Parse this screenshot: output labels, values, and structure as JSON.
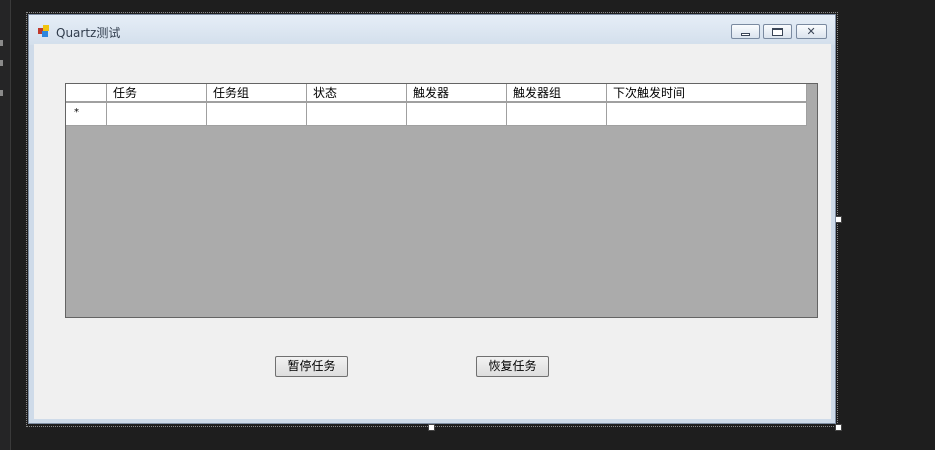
{
  "window": {
    "title": "Quartz测试"
  },
  "grid": {
    "columns": [
      "任务",
      "任务组",
      "状态",
      "触发器",
      "触发器组",
      "下次触发时间"
    ],
    "new_row_marker": "*"
  },
  "buttons": {
    "pause": "暂停任务",
    "resume": "恢复任务"
  }
}
